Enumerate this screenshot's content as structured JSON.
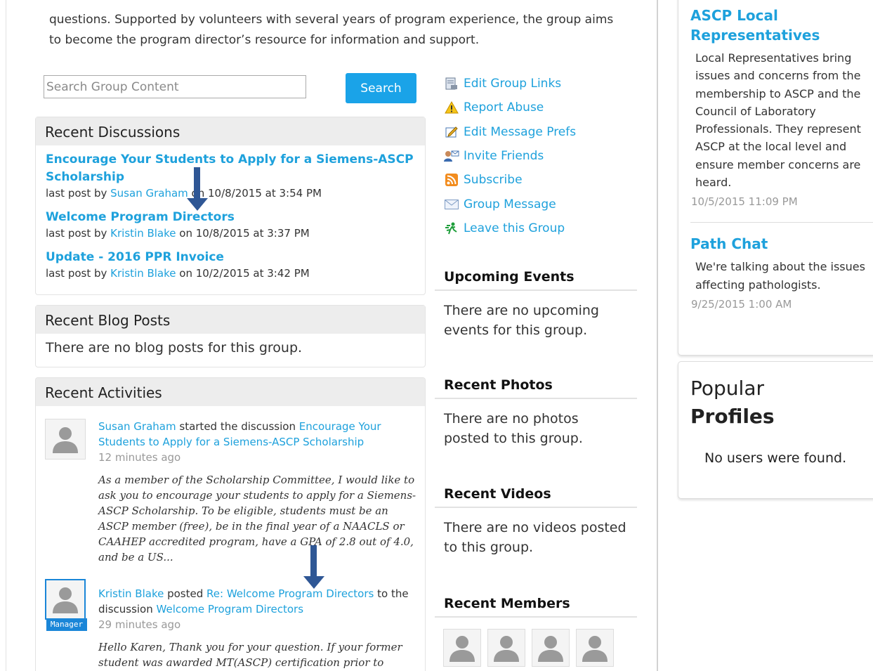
{
  "intro": {
    "text": "questions. Supported by volunteers with several years of program experience, the group aims to become the program director’s resource for information and support."
  },
  "search": {
    "placeholder": "Search Group Content",
    "button_label": "Search"
  },
  "recent_discussions": {
    "title": "Recent Discussions",
    "items": [
      {
        "title": "Encourage Your Students to Apply for a Siemens-ASCP Scholarship",
        "prefix": "last post by ",
        "author": "Susan Graham",
        "suffix": " on 10/8/2015 at 3:54 PM"
      },
      {
        "title": "Welcome Program Directors",
        "prefix": "last post by ",
        "author": "Kristin Blake",
        "suffix": " on 10/8/2015 at 3:37 PM"
      },
      {
        "title": "Update - 2016 PPR Invoice",
        "prefix": "last post by ",
        "author": "Kristin Blake",
        "suffix": " on 10/2/2015 at 3:42 PM"
      }
    ]
  },
  "recent_blog_posts": {
    "title": "Recent Blog Posts",
    "empty": "There are no blog posts for this group."
  },
  "recent_activities": {
    "title": "Recent Activities",
    "items": [
      {
        "user": "Susan Graham",
        "action": " started the discussion ",
        "target": "Encourage Your Students to Apply for a Siemens-ASCP Scholarship",
        "time": "12 minutes ago",
        "quote": "As a member of the Scholarship Committee, I would like to ask you to encourage your students to apply for a Siemens-ASCP Scholarship. To be eligible, students must be an ASCP member (free), be in the final year of a NAACLS or CAAHEP accredited program, have a GPA of 2.8 out of 4.0, and be a US..."
      },
      {
        "user": "Kristin Blake",
        "action": " posted ",
        "target": "Re: Welcome Program Directors",
        "mid": " to the discussion ",
        "target2": "Welcome Program Directors",
        "time": "29 minutes ago",
        "badge": "Manager",
        "quote": "Hello Karen, Thank you for your question.  If your former student was awarded MT(ASCP) certification prior to"
      }
    ]
  },
  "group_links": [
    {
      "label": "Edit Group Links",
      "icon": "edit-links-icon"
    },
    {
      "label": "Report Abuse",
      "icon": "warning-icon"
    },
    {
      "label": "Edit Message Prefs",
      "icon": "edit-prefs-icon"
    },
    {
      "label": "Invite Friends",
      "icon": "invite-friends-icon"
    },
    {
      "label": "Subscribe",
      "icon": "rss-icon"
    },
    {
      "label": "Group Message",
      "icon": "envelope-icon"
    },
    {
      "label": "Leave this Group",
      "icon": "leave-icon"
    }
  ],
  "upcoming_events": {
    "title": "Upcoming Events",
    "empty": "There are no upcoming events for this group."
  },
  "recent_photos": {
    "title": "Recent Photos",
    "empty": "There are no photos posted to this group."
  },
  "recent_videos": {
    "title": "Recent Videos",
    "empty": "There are no videos posted to this group."
  },
  "recent_members": {
    "title": "Recent Members"
  },
  "right_column": {
    "communities": [
      {
        "title": "ASCP Local Representatives",
        "text": "Local Representatives bring issues and concerns from the membership to ASCP and the Council of Laboratory Professionals. They represent ASCP at the local level and ensure member concerns are heard.",
        "date": "10/5/2015 11:09 PM"
      },
      {
        "title": "Path Chat",
        "text": "We're talking about the issues affecting pathologists.",
        "date": "9/25/2015 1:00 AM"
      }
    ],
    "popular_profiles": {
      "title_line1": "Popular",
      "title_line2": "Profiles",
      "empty": "No users were found."
    }
  },
  "colors": {
    "link": "#1ea1dc",
    "search_button": "#1aa3e8",
    "arrow": "#2f5795",
    "manager_badge": "#1a86d8"
  }
}
